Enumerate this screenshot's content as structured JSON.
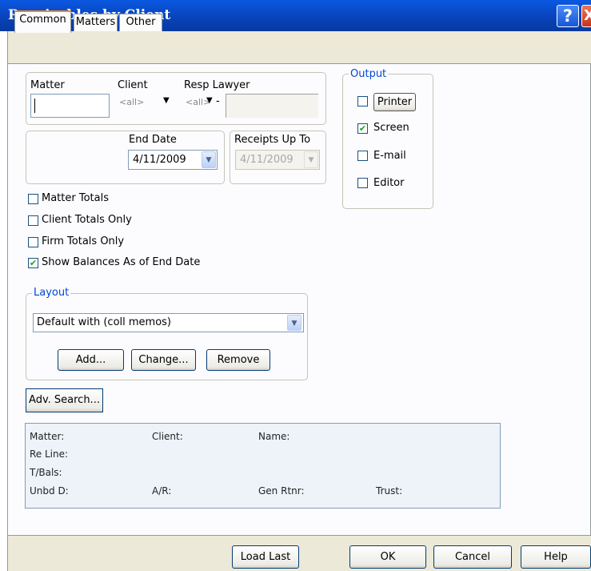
{
  "window": {
    "title": "Receivables by Client",
    "help_glyph": "?",
    "close_glyph": "X"
  },
  "tabs": [
    {
      "label": "Common",
      "active": true
    },
    {
      "label": "Matters",
      "active": false
    },
    {
      "label": "Other",
      "active": false
    }
  ],
  "filters": {
    "matter_label": "Matter",
    "matter_value": "",
    "client_label": "Client",
    "client_value": "<all>",
    "resp_lawyer_label": "Resp Lawyer",
    "resp_lawyer_value": "<all>",
    "resp_lawyer_sep": "-"
  },
  "dates": {
    "end_date_label": "End Date",
    "end_date_value": "4/11/2009",
    "receipts_label": "Receipts Up To",
    "receipts_value": "4/11/2009"
  },
  "output": {
    "legend": "Output",
    "printer_label": "Printer",
    "printer_checked": false,
    "screen_label": "Screen",
    "screen_checked": true,
    "email_label": "E-mail",
    "email_checked": false,
    "editor_label": "Editor",
    "editor_checked": false
  },
  "options": {
    "matter_totals": {
      "label": "Matter Totals",
      "checked": false
    },
    "client_totals": {
      "label": "Client Totals Only",
      "checked": false
    },
    "firm_totals": {
      "label": "Firm Totals Only",
      "checked": false
    },
    "show_balances": {
      "label": "Show Balances As of End Date",
      "checked": true
    }
  },
  "layout": {
    "legend": "Layout",
    "selected": "Default with (coll memos)",
    "add_label": "Add...",
    "change_label": "Change...",
    "remove_label": "Remove"
  },
  "adv_search_label": "Adv. Search...",
  "info": {
    "matter": "Matter:",
    "client": "Client:",
    "name": "Name:",
    "re_line": "Re Line:",
    "t_bals": "T/Bals:",
    "unbd": "Unbd D:",
    "ar": "A/R:",
    "gen_rtnr": "Gen Rtnr:",
    "trust": "Trust:"
  },
  "footer": {
    "load_last_label": "Load Last",
    "ok_label": "OK",
    "cancel_label": "Cancel",
    "help_label": "Help"
  },
  "check_glyph": "✔",
  "combo_glyph": "▼",
  "colors": {
    "title_bar": "#0842b8",
    "legend_text": "#0046d5",
    "dialog_bg": "#ece9d8",
    "check_mark": "#21a121"
  }
}
